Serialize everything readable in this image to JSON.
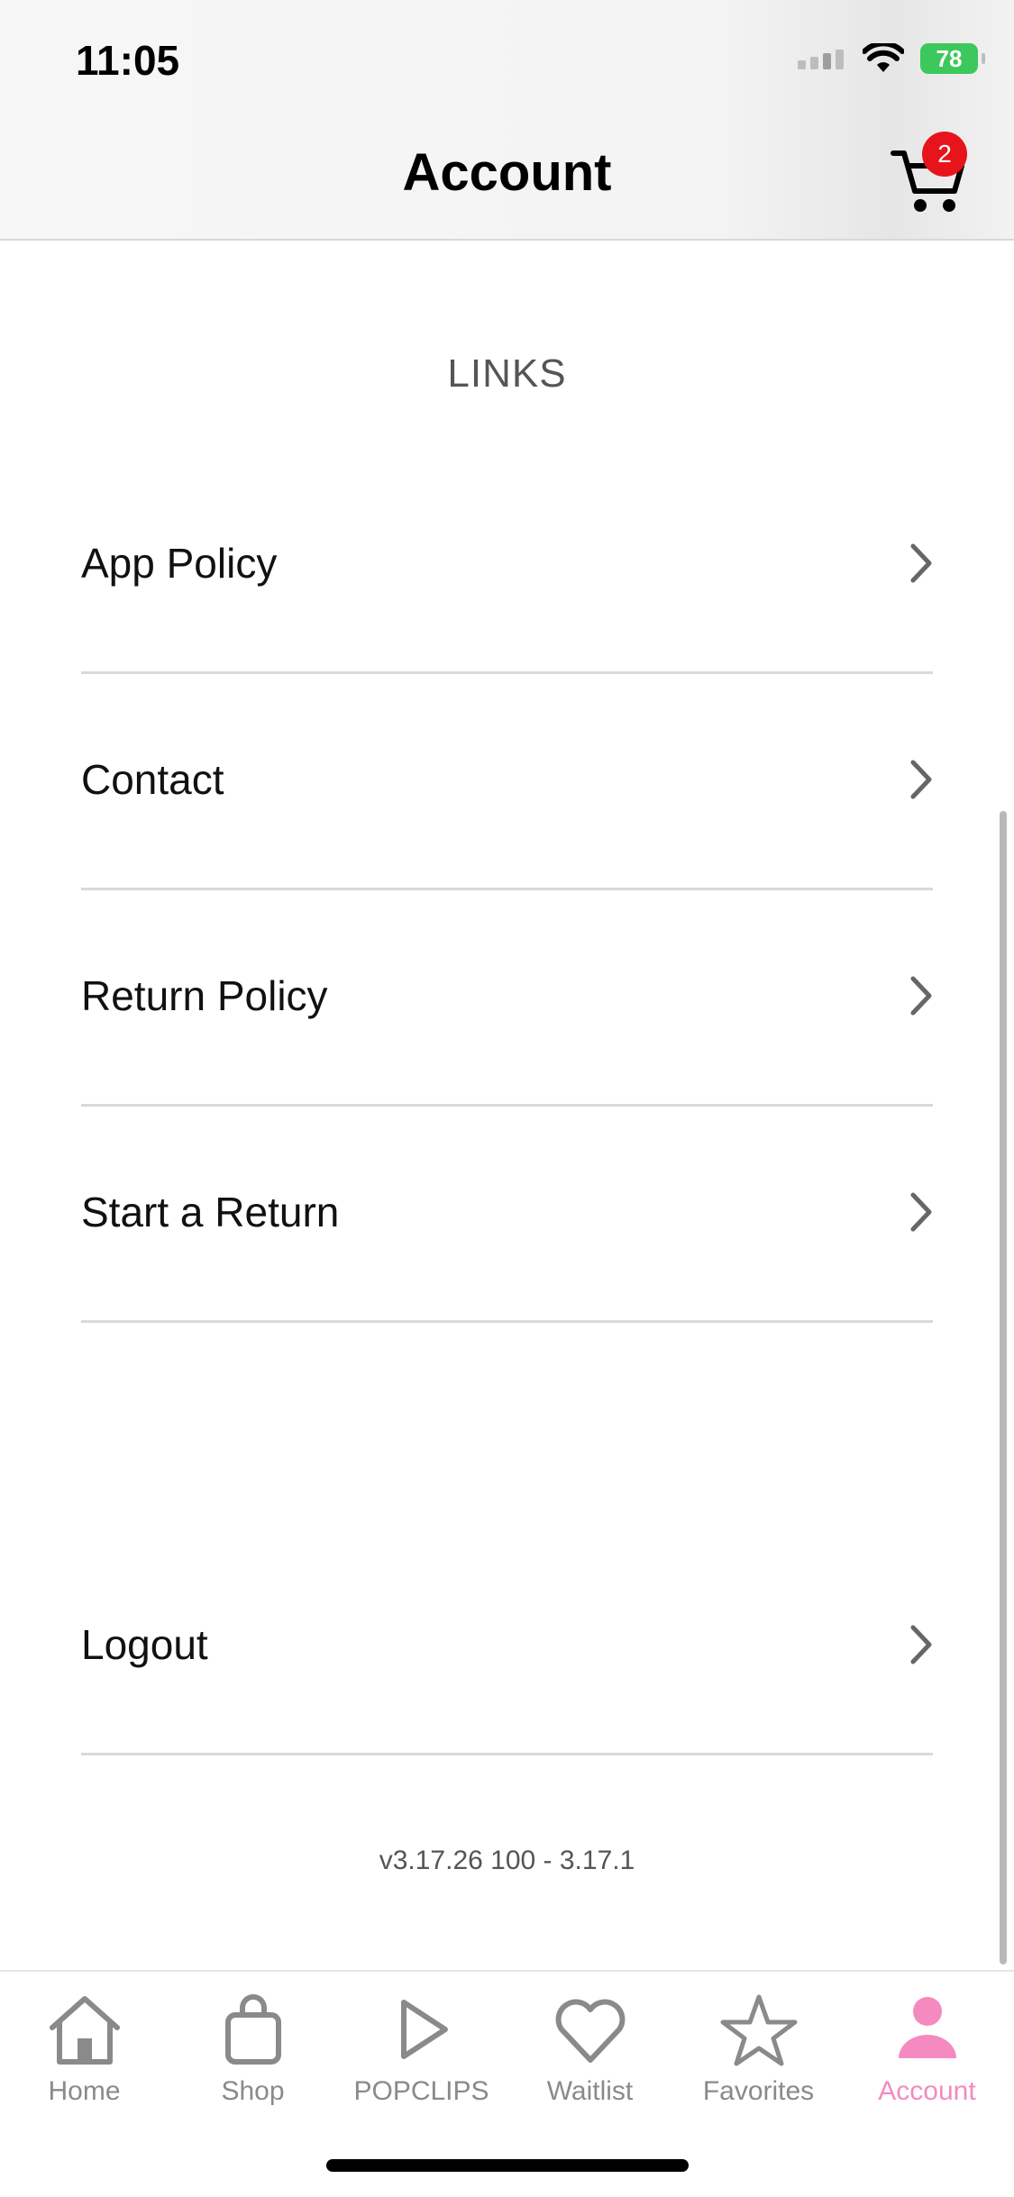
{
  "status_bar": {
    "time": "11:05",
    "battery": "78"
  },
  "header": {
    "title": "Account",
    "cart_count": "2"
  },
  "links": {
    "heading": "LINKS",
    "items": [
      {
        "label": "App Policy"
      },
      {
        "label": "Contact"
      },
      {
        "label": "Return Policy"
      },
      {
        "label": "Start a Return"
      }
    ]
  },
  "logout": {
    "label": "Logout"
  },
  "version": "v3.17.26 100 - 3.17.1",
  "tabs": [
    {
      "label": "Home",
      "icon": "home-icon"
    },
    {
      "label": "Shop",
      "icon": "shopping-bag-icon"
    },
    {
      "label": "POPCLIPS",
      "icon": "play-icon"
    },
    {
      "label": "Waitlist",
      "icon": "heart-icon"
    },
    {
      "label": "Favorites",
      "icon": "star-icon"
    },
    {
      "label": "Account",
      "icon": "person-icon",
      "active": true
    }
  ],
  "colors": {
    "accent": "#f48ac0",
    "badge": "#e8141b",
    "battery": "#3cc85c"
  }
}
